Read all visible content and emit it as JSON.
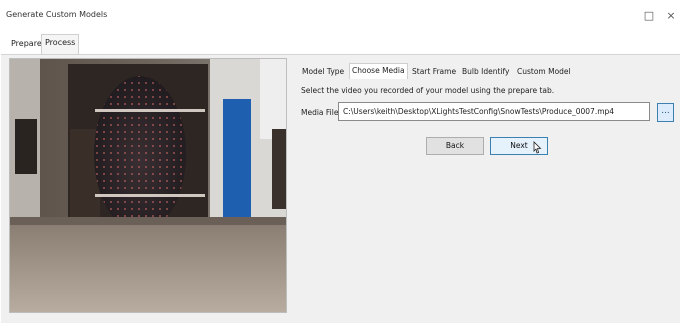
{
  "window": {
    "title": "Generate Custom Models",
    "maximize_icon": "□",
    "close_icon": "×"
  },
  "outer_tabs": [
    {
      "label": "Prepare",
      "active": false
    },
    {
      "label": "Process",
      "active": true
    }
  ],
  "preview": {
    "icon": "video-frame"
  },
  "inner_tabs": [
    {
      "label": "Model Type",
      "active": false
    },
    {
      "label": "Choose Media",
      "active": true
    },
    {
      "label": "Start Frame",
      "active": false
    },
    {
      "label": "Bulb Identify",
      "active": false
    },
    {
      "label": "Custom Model",
      "active": false
    }
  ],
  "choose_media": {
    "instruction": "Select the video you recorded of your model using the prepare tab.",
    "media_file_label": "Media File",
    "media_file_value": "C:\\Users\\keith\\Desktop\\XLightsTestConfig\\SnowTests\\Produce_0007.mp4",
    "browse_label": "..."
  },
  "buttons": {
    "back": "Back",
    "next": "Next"
  }
}
